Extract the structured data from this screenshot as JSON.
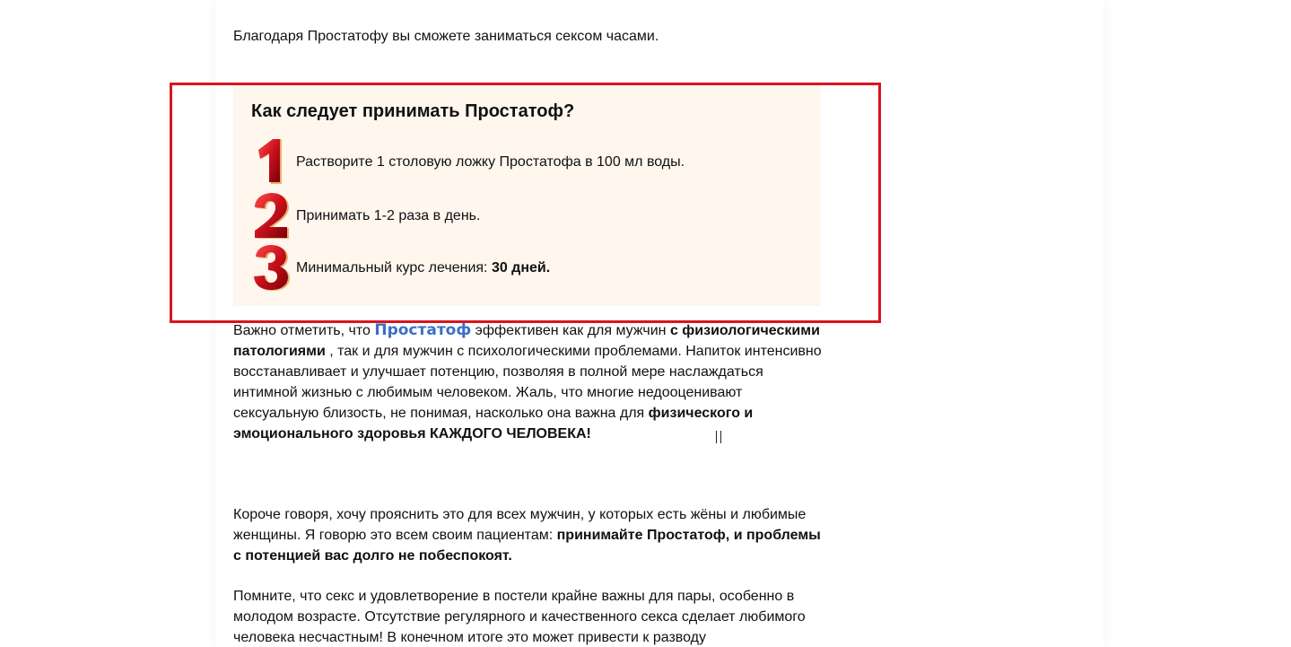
{
  "intro_text": "Благодаря Простатофу вы сможете заниматься сексом часами.",
  "howto": {
    "title": "Как следует принимать Простатоф?",
    "steps": [
      {
        "number": "1",
        "icon": "red-number-one-icon",
        "text": "Растворите 1 столовую ложку Простатофа в 100 мл воды."
      },
      {
        "number": "2",
        "icon": "red-number-two-icon",
        "text": "Принимать 1-2 раза в день."
      },
      {
        "number": "3",
        "icon": "red-number-three-icon",
        "text_prefix": "Минимальный курс лечения: ",
        "text_bold": "30 дней."
      }
    ]
  },
  "para1": {
    "t1": "Важно отметить, что ",
    "link": "Простатоф",
    "t2": " эффективен как для мужчин ",
    "b1": "с физиологическими патологиями",
    "t3": " , так и для мужчин с психологическими проблемами. Напиток интенсивно восстанавливает и улучшает потенцию, позволяя в полной мере наслаждаться интимной жизнью с любимым человеком. Жаль, что многие недооценивают сексуальную близость, не понимая, насколько она важна для ",
    "b2": "физического и эмоционального здоровья КАЖДОГО ЧЕЛОВЕКА!"
  },
  "para2": {
    "t1": "Короче говоря, хочу прояснить это для всех мужчин, у которых есть жёны и любимые женщины. Я говорю это всем своим пациентам: ",
    "b1": "принимайте Простатоф, и проблемы с потенцией вас долго не побеспокоят."
  },
  "para3": {
    "t1": "Помните, что секс и удовлетворение в постели крайне важны для пары, особенно в молодом возрасте. Отсутствие регулярного и качественного секса сделает любимого человека несчастным! В конечном итоге это может привести к разводу"
  },
  "colors": {
    "highlight_frame": "#d9141e",
    "box_background": "#fff6ee",
    "link": "#3a6fc8",
    "number_red": "#c8101c"
  }
}
